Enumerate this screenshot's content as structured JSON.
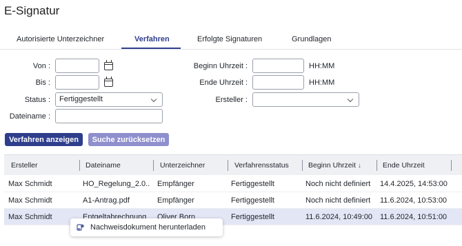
{
  "page": {
    "title": "E-Signatur"
  },
  "tabs": [
    {
      "label": "Autorisierte Unterzeichner",
      "active": false
    },
    {
      "label": "Verfahren",
      "active": true
    },
    {
      "label": "Erfolgte Signaturen",
      "active": false
    },
    {
      "label": "Grundlagen",
      "active": false
    }
  ],
  "filters": {
    "von_label": "Von :",
    "von_value": "",
    "bis_label": "Bis :",
    "bis_value": "",
    "status_label": "Status :",
    "status_value": "Fertiggestellt",
    "dateiname_label": "Dateiname :",
    "dateiname_value": "",
    "beginn_label": "Beginn Uhrzeit :",
    "beginn_value": "",
    "beginn_unit": "HH:MM",
    "ende_label": "Ende Uhrzeit :",
    "ende_value": "",
    "ende_unit": "HH:MM",
    "ersteller_label": "Ersteller :",
    "ersteller_value": ""
  },
  "buttons": {
    "show": "Verfahren anzeigen",
    "reset": "Suche zurücksetzen"
  },
  "table": {
    "columns": [
      "Ersteller",
      "Dateiname",
      "Unterzeichner",
      "Verfahrensstatus",
      "Beginn Uhrzeit",
      "Ende Uhrzeit"
    ],
    "sort_indicator": "↓",
    "rows": [
      [
        "Max Schmidt",
        "HO_Regelung_2.0....",
        "Empfänger",
        "Fertiggestellt",
        "Noch nicht definiert",
        "14.4.2025, 14:53:00"
      ],
      [
        "Max Schmidt",
        "A1-Antrag.pdf",
        "Empfänger",
        "Fertiggestellt",
        "Noch nicht definiert",
        "11.6.2024, 10:53:00"
      ],
      [
        "Max Schmidt",
        "Entgeltabrechnung",
        "Oliver Born",
        "Fertiggestellt",
        "11.6.2024, 10:49:00",
        "11.6.2024, 10:51:00"
      ]
    ]
  },
  "context_menu": {
    "item_label": "Nachweisdokument herunterladen",
    "item_icon": "document-download-icon"
  },
  "colors": {
    "primary": "#2f3e8c",
    "secondary": "#8f8fcd",
    "selected_row": "#e3e6f5"
  }
}
